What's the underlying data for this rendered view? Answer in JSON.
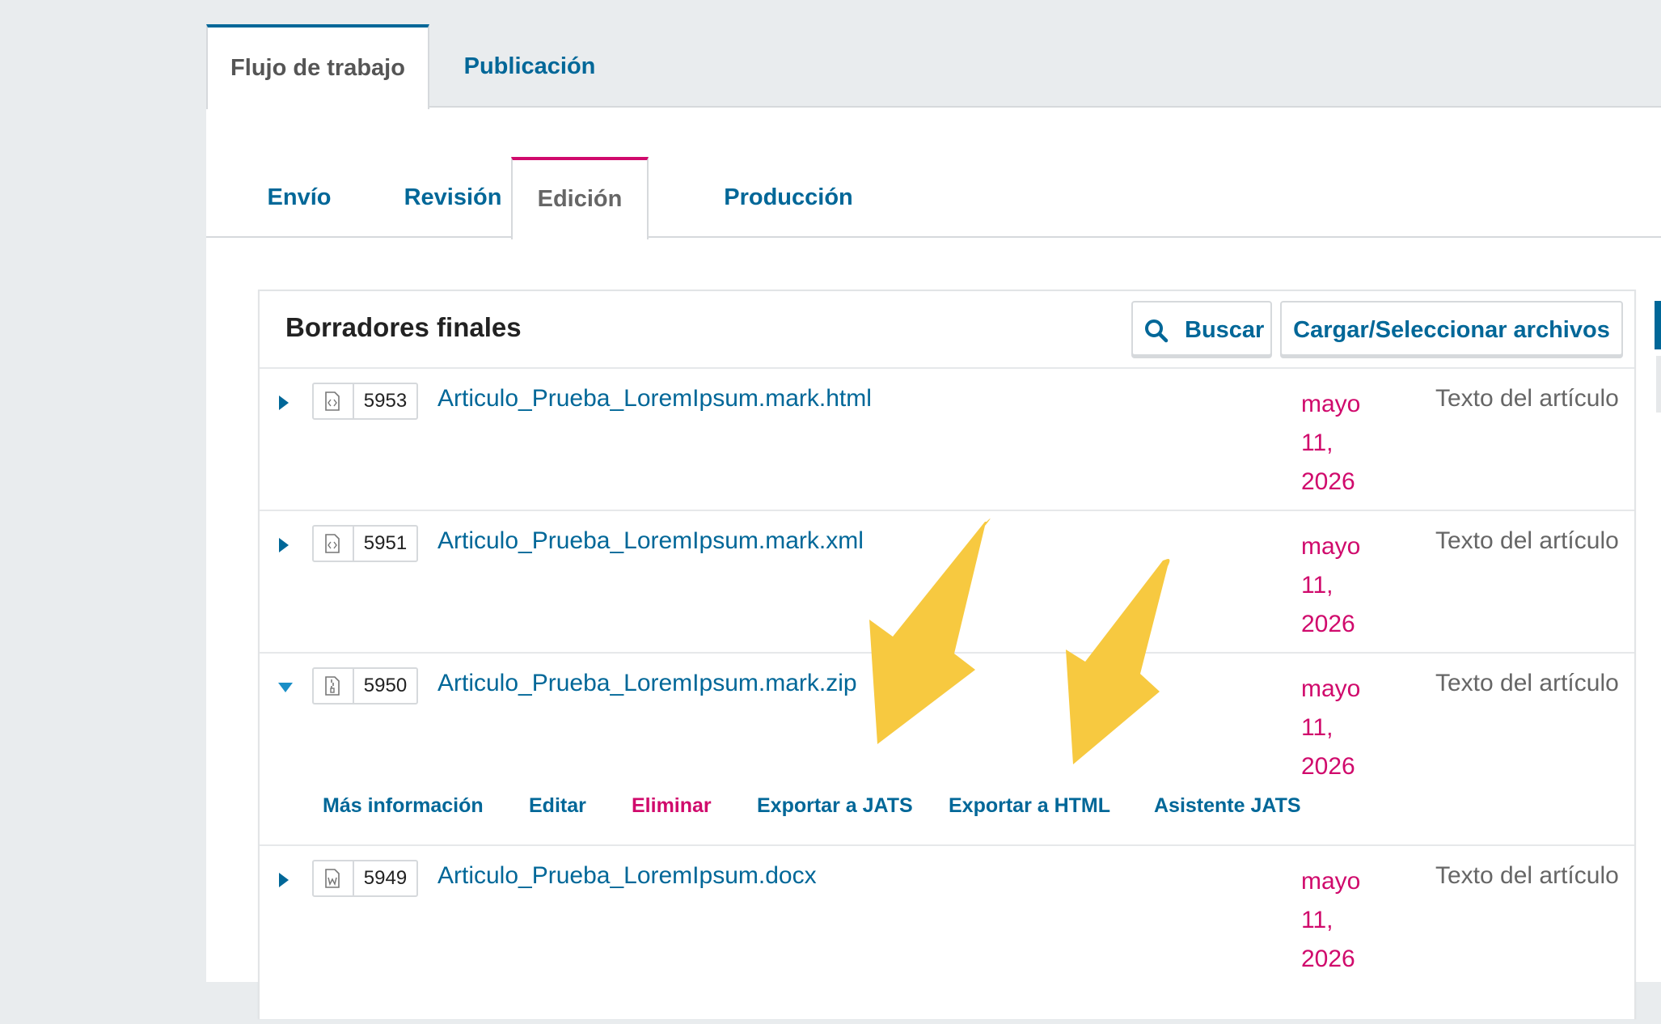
{
  "top_tabs": [
    {
      "label": "Flujo de trabajo",
      "active": true
    },
    {
      "label": "Publicación",
      "active": false
    }
  ],
  "stage_tabs": [
    {
      "label": "Envío",
      "active": false
    },
    {
      "label": "Revisión",
      "active": false
    },
    {
      "label": "Edición",
      "active": true
    },
    {
      "label": "Producción",
      "active": false
    }
  ],
  "panel": {
    "title": "Borradores finales",
    "search_label": "Buscar",
    "upload_label": "Cargar/Seleccionar archivos"
  },
  "files": [
    {
      "id": "5953",
      "name": "Articulo_Prueba_LoremIpsum.mark.html",
      "icon": "code-file-icon",
      "date": [
        "mayo",
        "11,",
        "2026"
      ],
      "type": "Texto del artículo",
      "expanded": false
    },
    {
      "id": "5951",
      "name": "Articulo_Prueba_LoremIpsum.mark.xml",
      "icon": "code-file-icon",
      "date": [
        "mayo",
        "11,",
        "2026"
      ],
      "type": "Texto del artículo",
      "expanded": false
    },
    {
      "id": "5950",
      "name": "Articulo_Prueba_LoremIpsum.mark.zip",
      "icon": "zip-file-icon",
      "date": [
        "mayo",
        "11,",
        "2026"
      ],
      "type": "Texto del artículo",
      "expanded": true
    },
    {
      "id": "5949",
      "name": "Articulo_Prueba_LoremIpsum.docx",
      "icon": "word-file-icon",
      "date": [
        "mayo",
        "11,",
        "2026"
      ],
      "type": "Texto del artículo",
      "expanded": false
    }
  ],
  "row_actions": [
    {
      "label": "Más información",
      "danger": false
    },
    {
      "label": "Editar",
      "danger": false
    },
    {
      "label": "Eliminar",
      "danger": true
    },
    {
      "label": "Exportar a JATS",
      "danger": false
    },
    {
      "label": "Exportar a HTML",
      "danger": false
    },
    {
      "label": "Asistente JATS",
      "danger": false
    }
  ],
  "colors": {
    "link": "#006798",
    "danger": "#d00a6c",
    "annotation_arrow": "#f7c940",
    "background": "#e9ecee"
  }
}
